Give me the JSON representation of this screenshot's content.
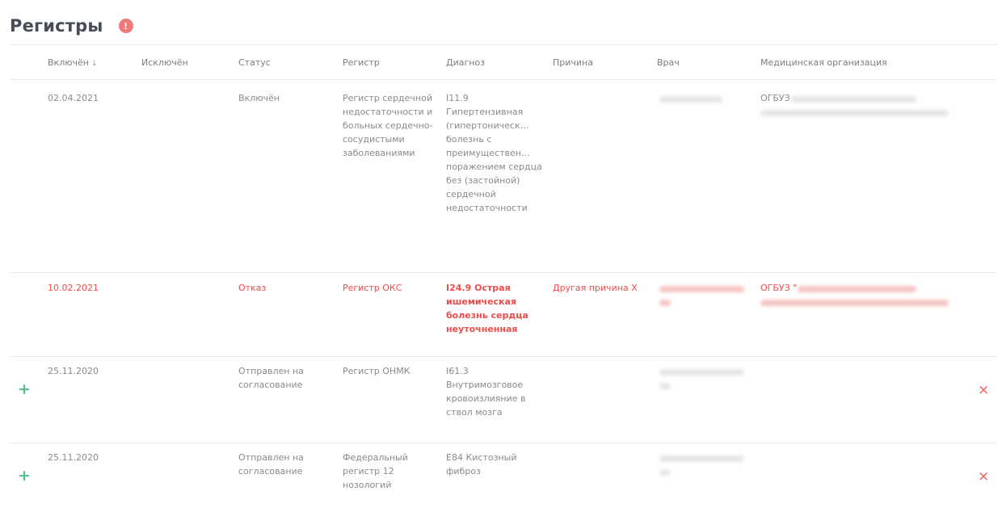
{
  "page": {
    "title": "Регистры",
    "alert_count": "!"
  },
  "columns": {
    "included": "Включён",
    "sort_icon": "↓",
    "excluded": "Исключён",
    "status": "Статус",
    "register": "Регистр",
    "diagnosis": "Диагноз",
    "reason": "Причина",
    "doctor": "Врач",
    "org": "Медицинская организация"
  },
  "rows": [
    {
      "included": "02.04.2021",
      "status": "Включён",
      "register": "Регистр сердечной недостаточности и больных сердечно-сосудистыми заболеваниями",
      "diagnosis": "I11.9 Гипертензивная (гипертоническ… болезнь с преимуществен… поражением сердца без (застойной) сердечной недостаточности",
      "reason": "",
      "org_prefix": "ОГБУЗ"
    },
    {
      "included": "10.02.2021",
      "status": "Отказ",
      "register": "Регистр ОКС",
      "diagnosis": "I24.9 Острая ишемическая болезнь сердца неуточненная",
      "reason": "Другая причина Х",
      "org_prefix": "ОГБУЗ \""
    },
    {
      "included": "25.11.2020",
      "status": "Отправлен на согласование",
      "register": "Регистр ОНМК",
      "diagnosis": "I61.3 Внутримозговое кровоизлияние в ствол мозга",
      "reason": ""
    },
    {
      "included": "25.11.2020",
      "status": "Отправлен на согласование",
      "register": "Федеральный регистр 12 нозологий",
      "diagnosis": "E84 Кистозный фиброз",
      "reason": ""
    }
  ],
  "actions": {
    "add": "+",
    "remove": "×"
  },
  "colors": {
    "danger": "#ef4c4c",
    "add": "#59c08f",
    "alert": "#ef7a7c",
    "title": "#474d57"
  }
}
